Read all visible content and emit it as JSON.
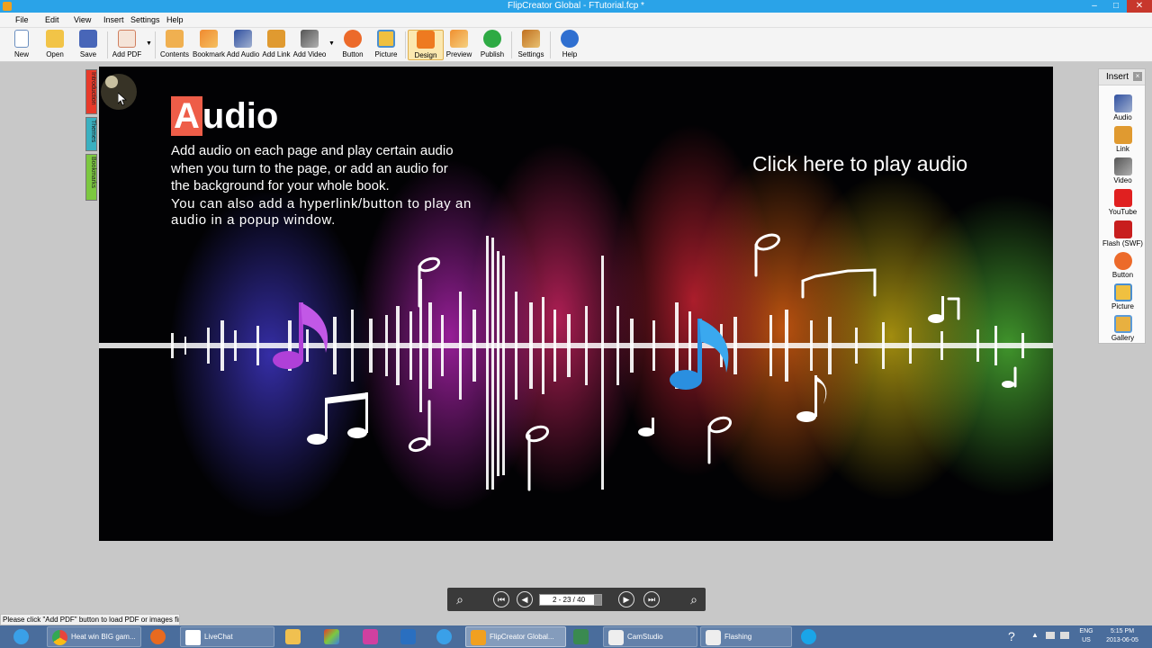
{
  "window": {
    "title": "FlipCreator Global - FTutorial.fcp *",
    "controls": [
      "–",
      "□",
      "✕"
    ]
  },
  "menu": [
    "File",
    "Edit",
    "View",
    "Insert",
    "Settings",
    "Help"
  ],
  "toolbar": {
    "new": "New",
    "open": "Open",
    "save": "Save",
    "add_pdf": "Add PDF",
    "contents": "Contents",
    "bookmark": "Bookmark",
    "add_audio": "Add Audio",
    "add_link": "Add Link",
    "add_video": "Add Video",
    "button": "Button",
    "picture": "Picture",
    "design": "Design",
    "preview": "Preview",
    "publish": "Publish",
    "settings": "Settings",
    "help": "Help"
  },
  "side_tabs": [
    "Introduction",
    "Themes",
    "Bookmarks"
  ],
  "page": {
    "heading_first": "A",
    "heading_rest": "udio",
    "desc_line1": "Add audio on each page and play certain audio",
    "desc_line2": "when you turn to the page, or add an audio for",
    "desc_line3": "the background for your whole book.",
    "desc_line4": "You can also add a hyperlink/button to play an",
    "desc_line5": "audio in a popup window.",
    "play_link": "Click here to play audio"
  },
  "insert_panel": {
    "title": "Insert",
    "items": [
      "Audio",
      "Link",
      "Video",
      "YouTube",
      "Flash (SWF)",
      "Button",
      "Picture",
      "Gallery"
    ]
  },
  "navigation": {
    "page_display": "2 - 23 / 40"
  },
  "status": "Please click \"Add PDF\" button to load PDF or images firs",
  "taskbar": {
    "chrome": "Heat win BIG gam...",
    "livechat": "LiveChat",
    "flipcreator": "FlipCreator Global...",
    "camstudio": "CamStudio",
    "flashing": "Flashing",
    "lang": "ENG",
    "region": "US",
    "time": "5:15 PM",
    "date": "2013-06-05"
  },
  "colors": {
    "titlebar": "#2aa3e8",
    "accent_red": "#ee5d48",
    "taskbar": "#4a6d9c"
  }
}
